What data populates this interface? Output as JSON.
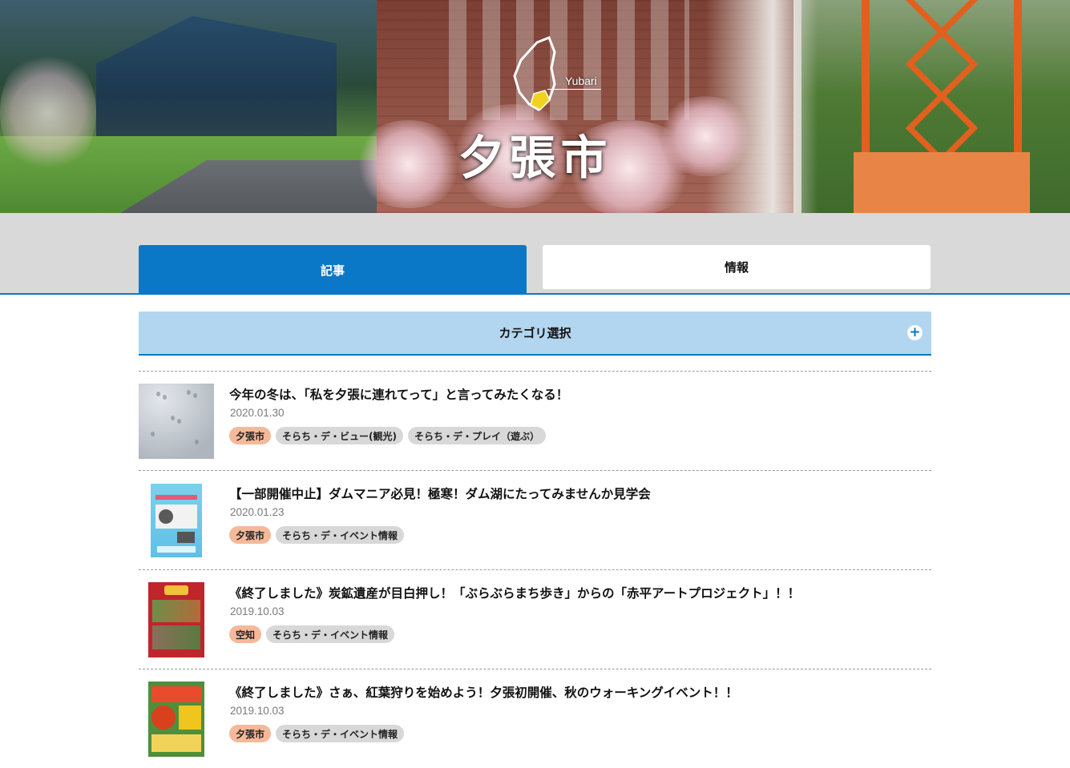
{
  "hero": {
    "title": "夕張市",
    "map_label": "Yubari"
  },
  "tabs": [
    {
      "label": "記事",
      "active": true
    },
    {
      "label": "情報",
      "active": false
    }
  ],
  "category": {
    "label": "カテゴリ選択",
    "toggle": "+"
  },
  "articles": [
    {
      "title": "今年の冬は、「私を夕張に連れてって」と言ってみたくなる！",
      "date": "2020.01.30",
      "tags": [
        "夕張市",
        "そらち・デ・ビュー(観光)",
        "そらち・デ・プレイ（遊ぶ）"
      ]
    },
    {
      "title": "【一部開催中止】ダムマニア必見！極寒！ダム湖にたってみませんか見学会",
      "date": "2020.01.23",
      "tags": [
        "夕張市",
        "そらち・デ・イベント情報"
      ]
    },
    {
      "title": "《終了しました》炭鉱遺産が目白押し！「ぶらぶらまち歩き」からの「赤平アートプロジェクト」！！",
      "date": "2019.10.03",
      "tags": [
        "空知",
        "そらち・デ・イベント情報"
      ]
    },
    {
      "title": "《終了しました》さぁ、紅葉狩りを始めよう！夕張初開催、秋のウォーキングイベント！！",
      "date": "2019.10.03",
      "tags": [
        "夕張市",
        "そらち・デ・イベント情報"
      ]
    }
  ],
  "colors": {
    "accent_blue": "#0b78c7",
    "category_bg": "#b3d6f0",
    "tab_band_bg": "#d9d9d9",
    "tag_area_bg": "#f5b99a",
    "tag_category_bg": "#d8d8d8"
  }
}
